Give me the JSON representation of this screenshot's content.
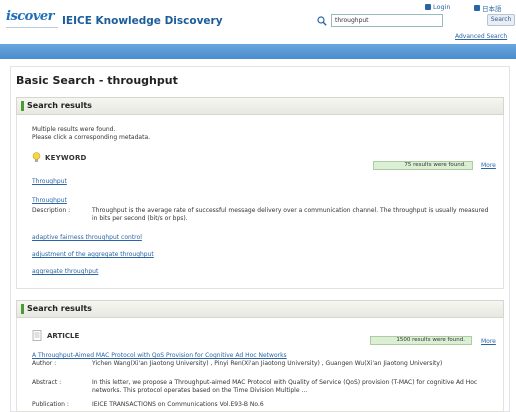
{
  "header": {
    "logo_text": "iscover",
    "site_title": "IEICE Knowledge Discovery",
    "login_label": "Login",
    "lang_label": "日本語",
    "search_value": "throughput",
    "search_button": "Search",
    "advanced_search": "Advanced Search"
  },
  "page": {
    "title": "Basic Search - throughput"
  },
  "results1": {
    "header": "Search results",
    "message_line1": "Multiple results were found.",
    "message_line2": "Please click a corresponding metadata.",
    "category_label": "KEYWORD",
    "count_text": "75 results were found.",
    "more": "More",
    "items": [
      {
        "title": "Throughput"
      },
      {
        "title": "Throughput"
      },
      {
        "title": "adaptive fairness throughput control"
      },
      {
        "title": "adjustment of the aggregate throughput"
      },
      {
        "title": "aggregate throughput"
      }
    ],
    "description_label": "Description :",
    "description_text": "Throughput is the average rate of successful message delivery over a communication channel. The throughput is usually measured in bits per second (bit/s or bps)."
  },
  "results2": {
    "header": "Search results",
    "category_label": "ARTICLE",
    "count_text": "1500 results were found.",
    "more": "More",
    "article_title": "A Throughput-Aimed MAC Protocol with QoS Provision for Cognitive Ad Hoc Networks",
    "author_label": "Author :",
    "author_text": "Yichen Wang(Xi'an Jiaotong University) , Pinyi Ren(Xi'an Jiaotong University) , Guangen Wu(Xi'an Jiaotong University)",
    "abstract_label": "Abstract :",
    "abstract_text": "In this letter, we propose a Throughput-aimed MAC Protocol with Quality of Service (QoS) provision (T-MAC) for cognitive Ad Hoc networks. This protocol operates based on the Time Division Multiple ...",
    "publication_label": "Publication :",
    "publication_text": "IEICE TRANSACTIONS on Communications Vol.E93-B No.6"
  },
  "colors": {
    "accent_blue": "#1b5c9b",
    "link": "#2a66a6",
    "header_bar": "#5b9ad6",
    "section_accent": "#4a9a3a",
    "count_bg": "#dcefd6"
  },
  "icons": [
    "search-icon",
    "lightbulb-icon",
    "document-icon",
    "login-icon",
    "language-icon"
  ]
}
